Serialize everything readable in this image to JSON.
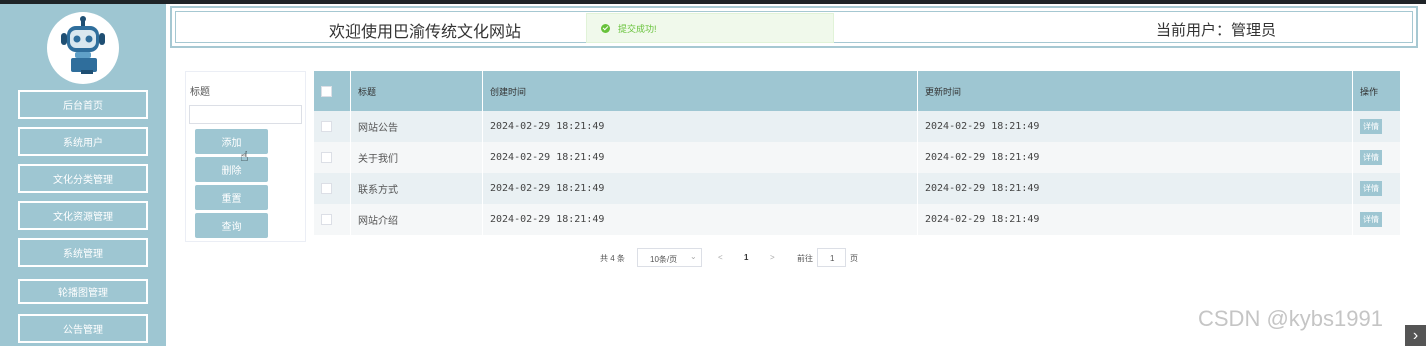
{
  "sidebar": {
    "items": [
      {
        "label": "后台首页"
      },
      {
        "label": "系统用户"
      },
      {
        "label": "文化分类管理"
      },
      {
        "label": "文化资源管理"
      },
      {
        "label": "系统管理"
      },
      {
        "label": "轮播图管理"
      },
      {
        "label": "公告管理"
      }
    ]
  },
  "header": {
    "welcome": "欢迎使用巴渝传统文化网站",
    "current_user": "当前用户：管理员"
  },
  "toast": {
    "message": "提交成功!"
  },
  "filter": {
    "title_label": "标题",
    "title_value": "",
    "buttons": {
      "add": "添加",
      "delete": "删除",
      "reset": "重置",
      "query": "查询"
    }
  },
  "table": {
    "headers": {
      "title": "标题",
      "created": "创建时间",
      "updated": "更新时间",
      "action": "操作"
    },
    "rows": [
      {
        "title": "网站公告",
        "created": "2024-02-29 18:21:49",
        "updated": "2024-02-29 18:21:49",
        "action": "详情"
      },
      {
        "title": "关于我们",
        "created": "2024-02-29 18:21:49",
        "updated": "2024-02-29 18:21:49",
        "action": "详情"
      },
      {
        "title": "联系方式",
        "created": "2024-02-29 18:21:49",
        "updated": "2024-02-29 18:21:49",
        "action": "详情"
      },
      {
        "title": "网站介绍",
        "created": "2024-02-29 18:21:49",
        "updated": "2024-02-29 18:21:49",
        "action": "详情"
      }
    ]
  },
  "pagination": {
    "total": "共 4 条",
    "page_size": "10条/页",
    "prev": "<",
    "current": "1",
    "next": ">",
    "goto_label": "前往",
    "goto_value": "1",
    "page_suffix": "页"
  },
  "watermark": "CSDN @kybs1991",
  "colors": {
    "accent": "#9ec6d2",
    "success": "#67c23a"
  },
  "icons": {
    "avatar": "robot-avatar-icon",
    "toast": "check-circle-icon",
    "cursor": "hand-cursor-icon"
  }
}
